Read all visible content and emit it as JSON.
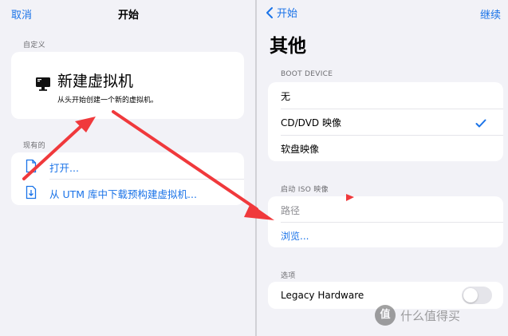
{
  "left": {
    "nav": {
      "cancel": "取消",
      "title": "开始"
    },
    "custom_header": "自定义",
    "new_vm": {
      "title": "新建虚拟机",
      "subtitle": "从头开始创建一个新的虚拟机。"
    },
    "existing_header": "现有的",
    "existing_items": [
      {
        "label": "打开...",
        "icon": "doc-icon"
      },
      {
        "label": "从 UTM 库中下载预构建虚拟机...",
        "icon": "download-icon"
      }
    ]
  },
  "right": {
    "nav": {
      "back": "开始",
      "next": "继续"
    },
    "title": "其他",
    "boot_header": "BOOT DEVICE",
    "boot_options": [
      {
        "label": "无",
        "selected": false
      },
      {
        "label": "CD/DVD 映像",
        "selected": true
      },
      {
        "label": "软盘映像",
        "selected": false
      }
    ],
    "iso_header": "启动 ISO 映像",
    "iso_path_placeholder": "路径",
    "iso_browse": "浏览...",
    "options_header": "选项",
    "legacy_label": "Legacy Hardware",
    "legacy_enabled": false
  },
  "watermark": "什么值得买",
  "colors": {
    "accent": "#1a73e8",
    "annotation": "#f0393c",
    "background": "#f2f2f7"
  }
}
